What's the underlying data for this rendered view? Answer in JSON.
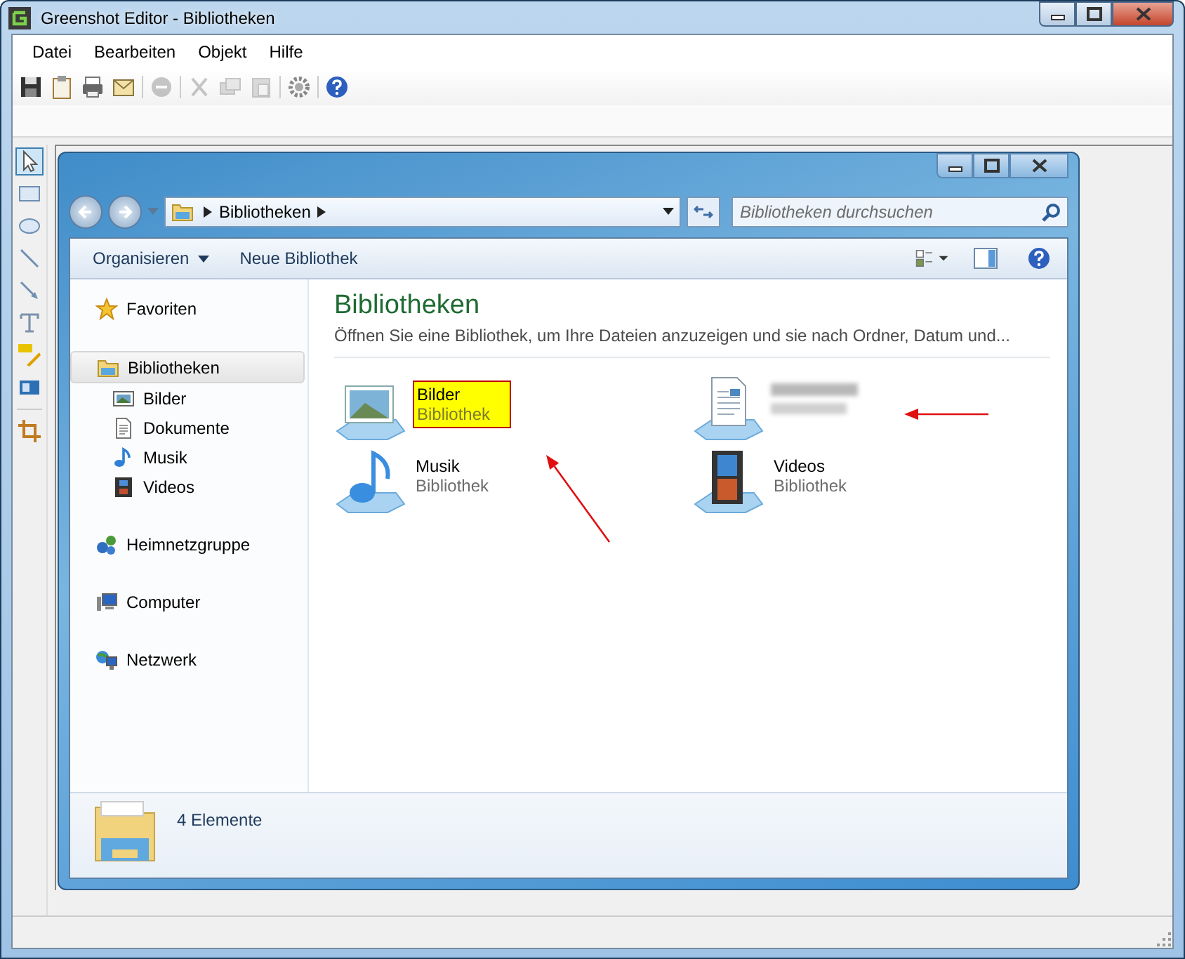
{
  "window": {
    "title": "Greenshot Editor - Bibliotheken"
  },
  "menu": [
    "Datei",
    "Bearbeiten",
    "Objekt",
    "Hilfe"
  ],
  "toolbar": [
    [
      {
        "kind": "save",
        "disabled": false
      },
      {
        "kind": "clipboard",
        "disabled": false
      },
      {
        "kind": "print",
        "disabled": false
      },
      {
        "kind": "email",
        "disabled": false
      }
    ],
    [
      {
        "kind": "delete",
        "disabled": true
      }
    ],
    [
      {
        "kind": "cut",
        "disabled": true
      },
      {
        "kind": "copy",
        "disabled": true
      },
      {
        "kind": "paste",
        "disabled": true
      }
    ],
    [
      {
        "kind": "settings",
        "disabled": false
      }
    ],
    [
      {
        "kind": "help",
        "disabled": false
      }
    ]
  ],
  "tools": [
    [
      {
        "kind": "select",
        "selected": true
      },
      {
        "kind": "rectangle",
        "selected": false
      },
      {
        "kind": "ellipse",
        "selected": false
      },
      {
        "kind": "line",
        "selected": false
      },
      {
        "kind": "arrow",
        "selected": false
      },
      {
        "kind": "text",
        "selected": false
      },
      {
        "kind": "highlight",
        "selected": false
      },
      {
        "kind": "obfuscate",
        "selected": false
      }
    ],
    [
      {
        "kind": "crop",
        "selected": false
      }
    ]
  ],
  "explorer": {
    "breadcrumb": [
      "Bibliotheken"
    ],
    "search": {
      "placeholder": "Bibliotheken durchsuchen"
    },
    "commands": [
      {
        "label": "Organisieren",
        "dropdown": true
      },
      {
        "label": "Neue Bibliothek",
        "dropdown": false
      }
    ],
    "nav": [
      {
        "label": "Favoriten",
        "kind": "favorites",
        "selected": false
      },
      {
        "label": "Bibliotheken",
        "kind": "libraries",
        "selected": true,
        "children": [
          {
            "label": "Bilder",
            "kind": "pictures",
            "selected": false
          },
          {
            "label": "Dokumente",
            "kind": "documents",
            "selected": false
          },
          {
            "label": "Musik",
            "kind": "music",
            "selected": false
          },
          {
            "label": "Videos",
            "kind": "videos",
            "selected": false
          }
        ]
      },
      {
        "label": "Heimnetzgruppe",
        "kind": "homegroup",
        "selected": false
      },
      {
        "label": "Computer",
        "kind": "computer",
        "selected": false
      },
      {
        "label": "Netzwerk",
        "kind": "network",
        "selected": false
      }
    ],
    "content": {
      "title": "Bibliotheken",
      "description": "Öffnen Sie eine Bibliothek, um Ihre Dateien anzuzeigen und sie nach Ordner, Datum und...",
      "items": [
        {
          "kind": "pictures",
          "name": "Bilder",
          "subtitle": "Bibliothek",
          "highlighted": true,
          "obscured": false
        },
        {
          "kind": "documents",
          "highlighted": false,
          "obscured": true
        },
        {
          "kind": "music",
          "name": "Musik",
          "subtitle": "Bibliothek",
          "highlighted": false,
          "obscured": false
        },
        {
          "kind": "videos",
          "name": "Videos",
          "subtitle": "Bibliothek",
          "highlighted": false,
          "obscured": false
        }
      ]
    },
    "details": "4 Elemente"
  },
  "annotations": [
    {
      "kind": "arrow"
    },
    {
      "kind": "arrow"
    }
  ]
}
